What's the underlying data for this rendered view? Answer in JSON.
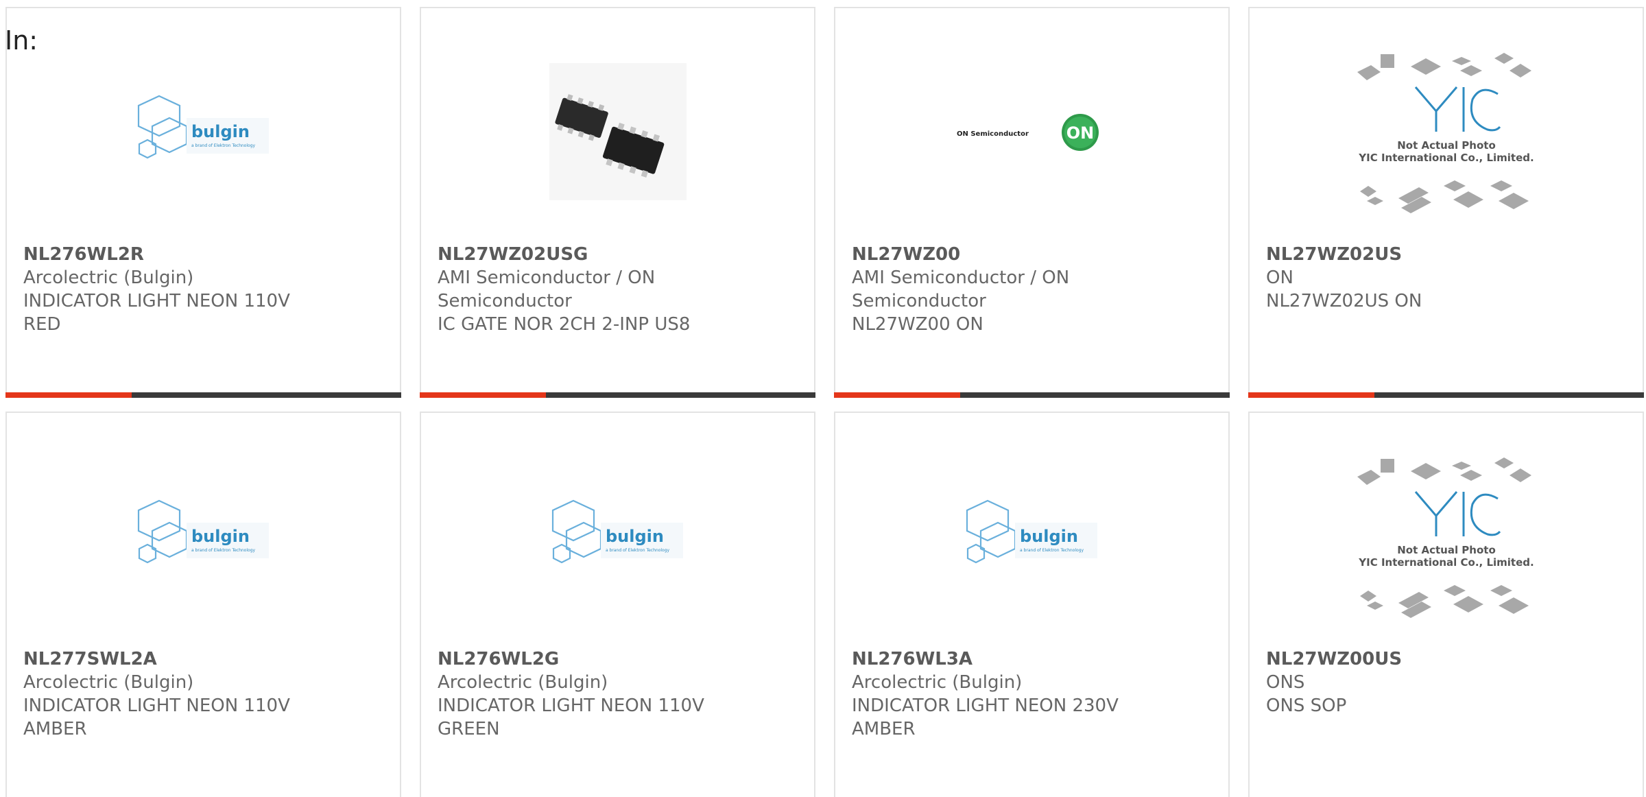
{
  "header": {
    "in_label": "In:"
  },
  "colors": {
    "accent": "#e4361a",
    "bar": "#3a3a3a",
    "text": "#666666",
    "bulgin_blue": "#2e8bc0",
    "on_green": "#2e9a4a"
  },
  "products": [
    {
      "part_number": "NL276WL2R",
      "manufacturer": "Arcolectric (Bulgin)",
      "description": "INDICATOR LIGHT NEON 110V RED",
      "image": "bulgin-logo",
      "logo_text": "bulgin",
      "logo_tagline": "a brand of Elektron Technology"
    },
    {
      "part_number": "NL27WZ02USG",
      "manufacturer": "AMI Semiconductor / ON Semiconductor",
      "description": "IC GATE NOR 2CH 2-INP US8",
      "image": "ic-chip-photo"
    },
    {
      "part_number": "NL27WZ00",
      "manufacturer": "AMI Semiconductor / ON Semiconductor",
      "description": "NL27WZ00 ON",
      "image": "on-semiconductor-logo",
      "logo_text": "ON Semiconductor",
      "logo_mark": "ON"
    },
    {
      "part_number": "NL27WZ02US",
      "manufacturer": "ON",
      "description": "NL27WZ02US ON",
      "image": "yic-placeholder",
      "yic_line1": "Not Actual Photo",
      "yic_line2": "YIC International Co., Limited."
    },
    {
      "part_number": "NL277SWL2A",
      "manufacturer": "Arcolectric (Bulgin)",
      "description": "INDICATOR LIGHT NEON 110V AMBER",
      "image": "bulgin-logo",
      "logo_text": "bulgin",
      "logo_tagline": "a brand of Elektron Technology"
    },
    {
      "part_number": "NL276WL2G",
      "manufacturer": "Arcolectric (Bulgin)",
      "description": "INDICATOR LIGHT NEON 110V GREEN",
      "image": "bulgin-logo",
      "logo_text": "bulgin",
      "logo_tagline": "a brand of Elektron Technology"
    },
    {
      "part_number": "NL276WL3A",
      "manufacturer": "Arcolectric (Bulgin)",
      "description": "INDICATOR LIGHT NEON 230V AMBER",
      "image": "bulgin-logo",
      "logo_text": "bulgin",
      "logo_tagline": "a brand of Elektron Technology"
    },
    {
      "part_number": "NL27WZ00US",
      "manufacturer": "ONS",
      "description": "ONS SOP",
      "image": "yic-placeholder",
      "yic_line1": "Not Actual Photo",
      "yic_line2": "YIC International Co., Limited."
    }
  ]
}
